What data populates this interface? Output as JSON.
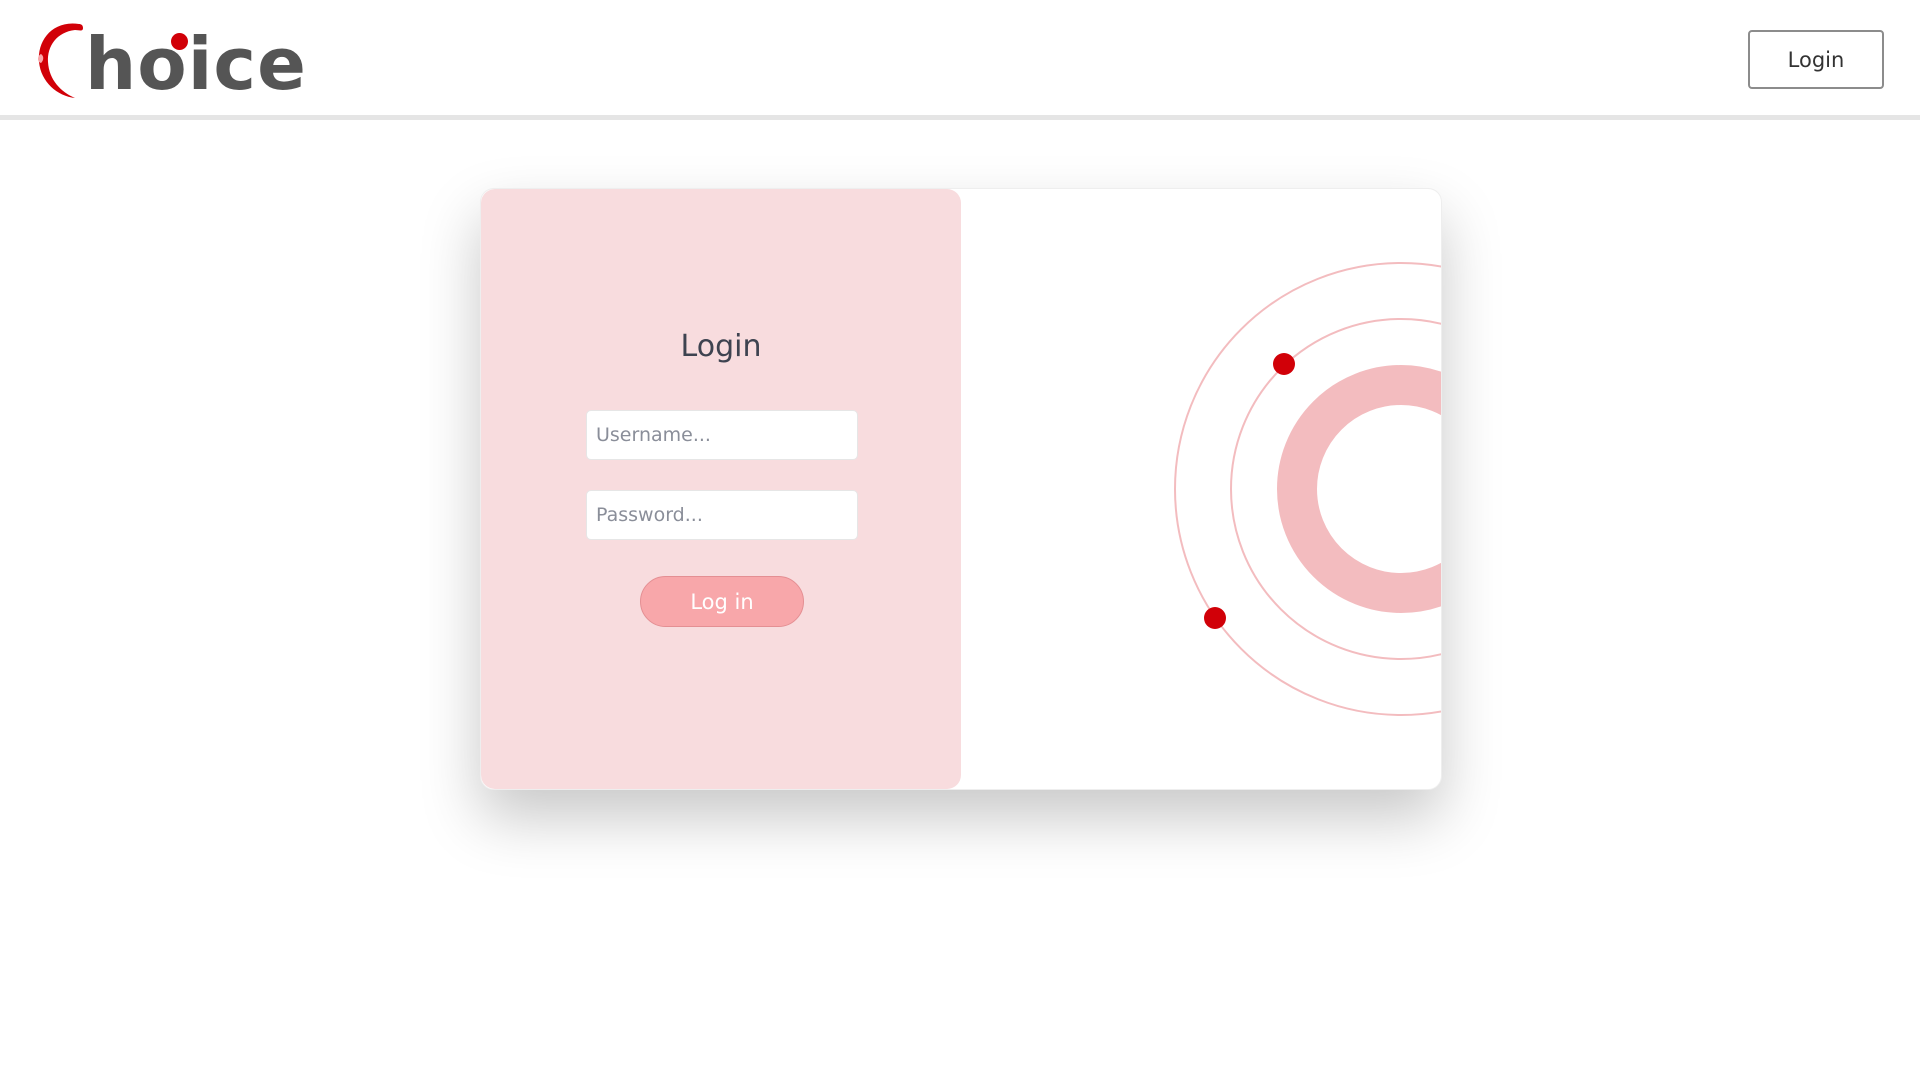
{
  "header": {
    "logo_text": "hoice",
    "login_button": "Login"
  },
  "login_form": {
    "title": "Login",
    "username_placeholder": "Username...",
    "password_placeholder": "Password...",
    "submit_label": "Log in"
  },
  "colors": {
    "brand_red": "#d10008",
    "panel_pink": "#f8dcde",
    "button_pink": "#f8a7aa",
    "ring_pink": "#f3bcbf"
  }
}
